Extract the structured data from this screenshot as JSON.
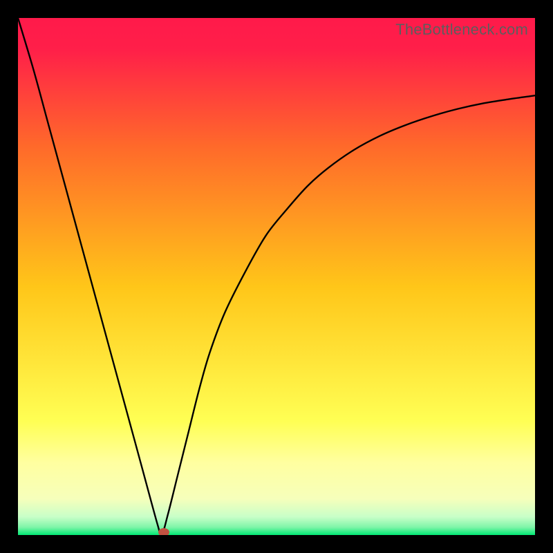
{
  "watermark": "TheBottleneck.com",
  "chart_data": {
    "type": "line",
    "title": "",
    "xlabel": "",
    "ylabel": "",
    "xlim": [
      0,
      100
    ],
    "ylim": [
      0,
      100
    ],
    "background_gradient": {
      "top_color": "#ff1a4a",
      "mid_upper_color": "#ff6a2a",
      "mid_color": "#ffc619",
      "mid_lower_color": "#ffff54",
      "near_bottom_color": "#f6ffbb",
      "bottom_color": "#00e874"
    },
    "series": [
      {
        "name": "bottleneck-curve",
        "x": [
          0,
          3,
          6,
          9,
          12,
          15,
          18,
          21,
          24,
          27,
          27.8,
          29,
          31,
          33,
          35,
          37,
          40,
          44,
          48,
          52,
          56,
          60,
          65,
          70,
          75,
          80,
          85,
          90,
          95,
          100
        ],
        "values": [
          100,
          90,
          79,
          68,
          57,
          46,
          35,
          24,
          13,
          2,
          0,
          4,
          12,
          20,
          28,
          35,
          43,
          51,
          58,
          63,
          67.5,
          71,
          74.5,
          77.2,
          79.3,
          81,
          82.4,
          83.5,
          84.3,
          85
        ]
      }
    ],
    "marker": {
      "x": 28.2,
      "y": 0.6,
      "color": "#c25242"
    }
  }
}
